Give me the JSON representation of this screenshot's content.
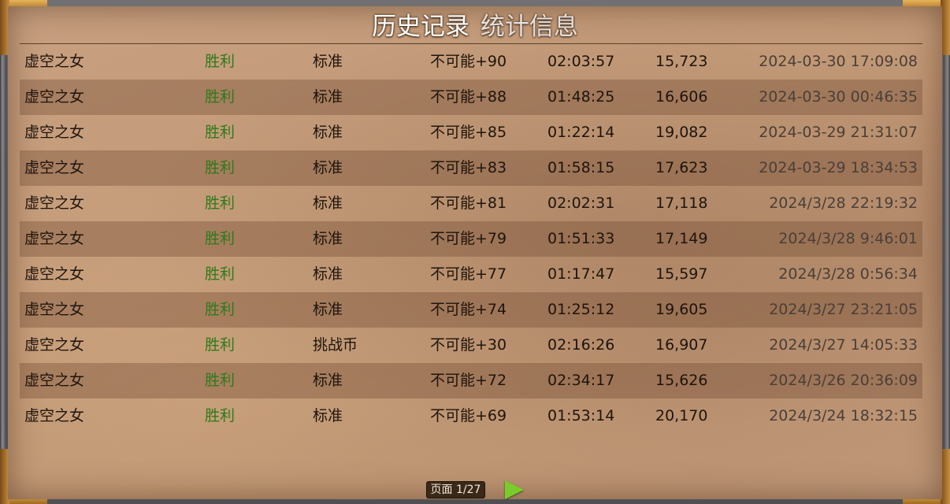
{
  "tabs": {
    "history": "历史记录",
    "stats": "统计信息"
  },
  "rows": [
    {
      "hero": "虚空之女",
      "result": "胜利",
      "mode": "标准",
      "difficulty": "不可能+90",
      "duration": "02:03:57",
      "score": "15,723",
      "date": "2024-03-30 17:09:08"
    },
    {
      "hero": "虚空之女",
      "result": "胜利",
      "mode": "标准",
      "difficulty": "不可能+88",
      "duration": "01:48:25",
      "score": "16,606",
      "date": "2024-03-30 00:46:35"
    },
    {
      "hero": "虚空之女",
      "result": "胜利",
      "mode": "标准",
      "difficulty": "不可能+85",
      "duration": "01:22:14",
      "score": "19,082",
      "date": "2024-03-29 21:31:07"
    },
    {
      "hero": "虚空之女",
      "result": "胜利",
      "mode": "标准",
      "difficulty": "不可能+83",
      "duration": "01:58:15",
      "score": "17,623",
      "date": "2024-03-29 18:34:53"
    },
    {
      "hero": "虚空之女",
      "result": "胜利",
      "mode": "标准",
      "difficulty": "不可能+81",
      "duration": "02:02:31",
      "score": "17,118",
      "date": "2024/3/28 22:19:32"
    },
    {
      "hero": "虚空之女",
      "result": "胜利",
      "mode": "标准",
      "difficulty": "不可能+79",
      "duration": "01:51:33",
      "score": "17,149",
      "date": "2024/3/28 9:46:01"
    },
    {
      "hero": "虚空之女",
      "result": "胜利",
      "mode": "标准",
      "difficulty": "不可能+77",
      "duration": "01:17:47",
      "score": "15,597",
      "date": "2024/3/28 0:56:34"
    },
    {
      "hero": "虚空之女",
      "result": "胜利",
      "mode": "标准",
      "difficulty": "不可能+74",
      "duration": "01:25:12",
      "score": "19,605",
      "date": "2024/3/27 23:21:05"
    },
    {
      "hero": "虚空之女",
      "result": "胜利",
      "mode": "挑战币",
      "difficulty": "不可能+30",
      "duration": "02:16:26",
      "score": "16,907",
      "date": "2024/3/27 14:05:33"
    },
    {
      "hero": "虚空之女",
      "result": "胜利",
      "mode": "标准",
      "difficulty": "不可能+72",
      "duration": "02:34:17",
      "score": "15,626",
      "date": "2024/3/26 20:36:09"
    },
    {
      "hero": "虚空之女",
      "result": "胜利",
      "mode": "标准",
      "difficulty": "不可能+69",
      "duration": "01:53:14",
      "score": "20,170",
      "date": "2024/3/24 18:32:15"
    }
  ],
  "footer": {
    "page_label": "页面 1/27",
    "next_icon": "play-triangle-icon",
    "next_color": "#7acc2a"
  },
  "colors": {
    "result_win": "#2d7a1a",
    "parchment": "#c39a78",
    "frame_gold": "#e8b45a"
  }
}
